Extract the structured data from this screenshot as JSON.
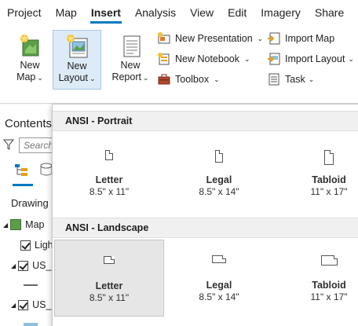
{
  "menu": {
    "tabs": [
      "Project",
      "Map",
      "Insert",
      "Analysis",
      "View",
      "Edit",
      "Imagery",
      "Share"
    ],
    "active": "Insert"
  },
  "ribbon": {
    "new_map": {
      "line1": "New",
      "line2": "Map"
    },
    "new_layout": {
      "line1": "New",
      "line2": "Layout"
    },
    "new_report": {
      "line1": "New",
      "line2": "Report"
    },
    "new_presentation": "New Presentation",
    "new_notebook": "New Notebook",
    "toolbox": "Toolbox",
    "import_map": "Import Map",
    "import_layout": "Import Layout",
    "task": "Task"
  },
  "contents": {
    "title": "Contents",
    "search_placeholder": "Search",
    "drawing_order": "Drawing",
    "map_label": "Map",
    "layers": [
      "Ligh",
      "US_r",
      "US_r"
    ]
  },
  "gallery": {
    "sections": [
      {
        "title": "ANSI - Portrait",
        "items": [
          {
            "name": "Letter",
            "size": "8.5\" x 11\""
          },
          {
            "name": "Legal",
            "size": "8.5\" x 14\""
          },
          {
            "name": "Tabloid",
            "size": "11\" x 17\""
          }
        ]
      },
      {
        "title": "ANSI - Landscape",
        "items": [
          {
            "name": "Letter",
            "size": "8.5\" x 11\""
          },
          {
            "name": "Legal",
            "size": "8.5\" x 14\""
          },
          {
            "name": "Tabloid",
            "size": "11\" x 17\""
          }
        ]
      }
    ]
  },
  "colors": {
    "accent": "#0079c1",
    "pressed": "#dcebf7",
    "selected_tile": "#e6e6e6"
  }
}
